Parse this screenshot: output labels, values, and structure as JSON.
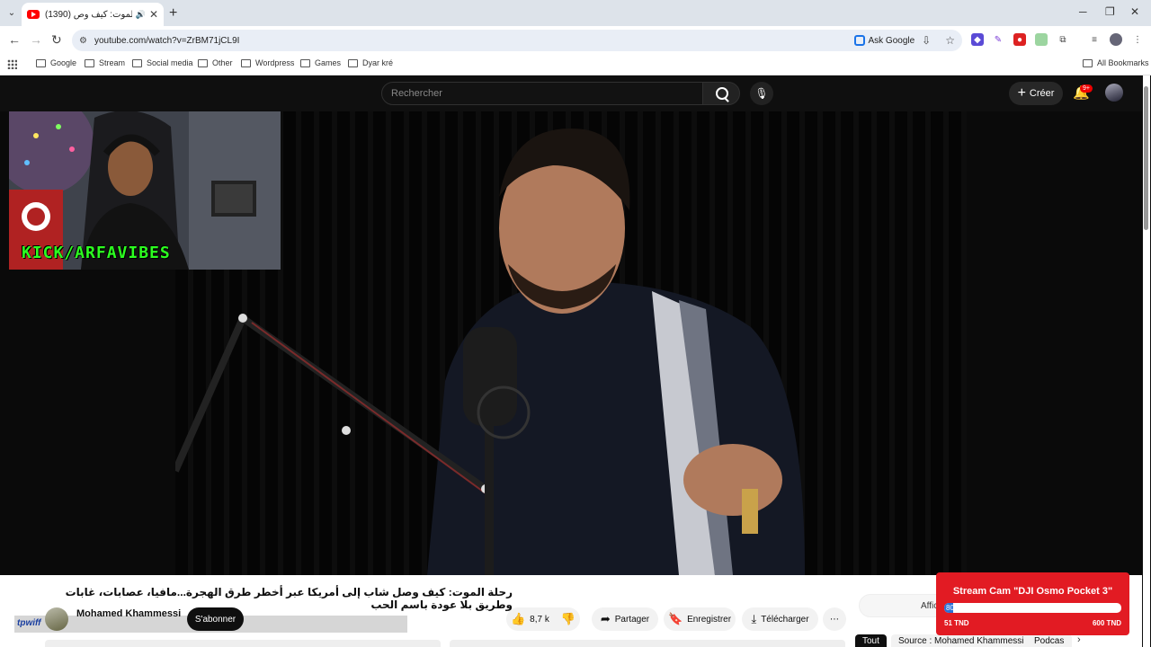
{
  "browser": {
    "tab": {
      "title": "(1390) رحلة الموت: كيف وص...",
      "audio_icon": "speaker-icon"
    },
    "url": "youtube.com/watch?v=ZrBM71jCL9I",
    "ask_google": "Ask Google",
    "bookmarks": [
      "Google",
      "Stream",
      "Social media",
      "Other",
      "Wordpress",
      "Games",
      "Dyar kré"
    ],
    "all_bookmarks": "All Bookmarks"
  },
  "youtube": {
    "search_placeholder": "Rechercher",
    "create_label": "Créer",
    "notifications_badge": "9+",
    "video_title": "رحلة الموت: كيف وصل شاب إلى أمريكا عبر أخطر طرق الهجرة...مافيا، عصابات، غابات وطريق بلا عودة باسم الحب",
    "channel_name": "Mohamed Khammessi",
    "subscribe_label": "S'abonner",
    "likes": "8,7 k",
    "share_label": "Partager",
    "save_label": "Enregistrer",
    "download_label": "Télécharger",
    "more_label": "⋯",
    "aff_label": "Affic",
    "chips": [
      "Tout",
      "Source : Mohamed Khammessi",
      "Podcas"
    ],
    "webcam_overlay": "KICK/ARFAVIBES",
    "blurred_tag": "tpwiff"
  },
  "stream_widget": {
    "title": "Stream Cam \"DJI Osmo Pocket 3\"",
    "progress_value": "80",
    "progress_fraction": 0.0333,
    "min": "51 TND",
    "max": "600 TND"
  },
  "colors": {
    "youtube_bg": "#0f0f0f",
    "widget_red": "#e21b23",
    "overlay_green": "#2cff20"
  }
}
